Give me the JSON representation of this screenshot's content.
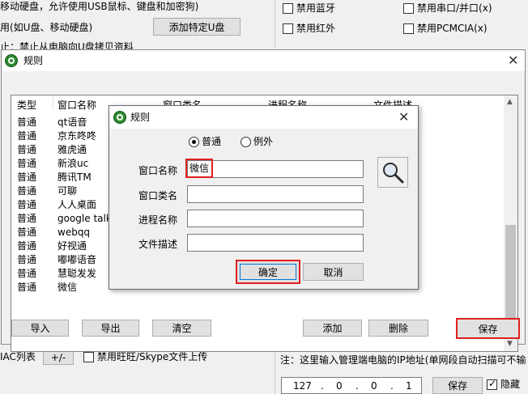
{
  "background": {
    "top_text_1": "移动硬盘，允许使用USB鼠标、键盘和加密狗)",
    "top_text_2": "用(如U盘、移动硬盘)",
    "top_text_3": "止：禁止从电脑向U盘拷贝资料",
    "add_udisk_button": "添加特定U盘",
    "checkboxes": [
      {
        "label": "禁用蓝牙",
        "checked": false
      },
      {
        "label": "禁用串口/并口(x)",
        "checked": false
      },
      {
        "label": "禁用红外",
        "checked": false
      },
      {
        "label": "禁用PCMCIA(x)",
        "checked": false
      }
    ],
    "mac_list_label": "IAC列表",
    "plus_minus_button": "+/-",
    "wangwang_checkbox": {
      "label": "禁用旺旺/Skype文件上传",
      "checked": false
    },
    "note_text": "注：这里输入管理端电脑的IP地址(单网段自动扫描可不输",
    "ip": [
      "127",
      "0",
      "0",
      "1"
    ],
    "ip_save_button": "保存",
    "hide_checkbox": {
      "label": "隐藏",
      "checked": true
    }
  },
  "rule_window": {
    "title": "规则",
    "columns": [
      "类型",
      "窗口名称",
      "窗口类名",
      "进程名称",
      "文件描述"
    ],
    "rows": [
      {
        "type": "普通",
        "name": "qt语音"
      },
      {
        "type": "普通",
        "name": "京东咚咚"
      },
      {
        "type": "普通",
        "name": "雅虎通"
      },
      {
        "type": "普通",
        "name": "新浪uc"
      },
      {
        "type": "普通",
        "name": "腾讯TM"
      },
      {
        "type": "普通",
        "name": "可聊"
      },
      {
        "type": "普通",
        "name": "人人桌面"
      },
      {
        "type": "普通",
        "name": "google talk"
      },
      {
        "type": "普通",
        "name": "webqq"
      },
      {
        "type": "普通",
        "name": "好视通"
      },
      {
        "type": "普通",
        "name": "嘟嘟语音"
      },
      {
        "type": "普通",
        "name": "慧聪发发"
      },
      {
        "type": "普通",
        "name": "微信"
      }
    ],
    "buttons": {
      "import": "导入",
      "export": "导出",
      "clear": "清空",
      "add": "添加",
      "delete": "删除",
      "save": "保存"
    }
  },
  "inner_dialog": {
    "title": "规则",
    "radio_normal": "普通",
    "radio_exception": "例外",
    "selected_radio": "普通",
    "fields": {
      "window_name": {
        "label": "窗口名称",
        "value": "微信"
      },
      "window_class": {
        "label": "窗口类名",
        "value": ""
      },
      "process_name": {
        "label": "进程名称",
        "value": ""
      },
      "file_desc": {
        "label": "文件描述",
        "value": ""
      }
    },
    "ok_button": "确定",
    "cancel_button": "取消"
  },
  "colors": {
    "highlight": "#e02020",
    "icon_green": "#2f8a2f"
  }
}
